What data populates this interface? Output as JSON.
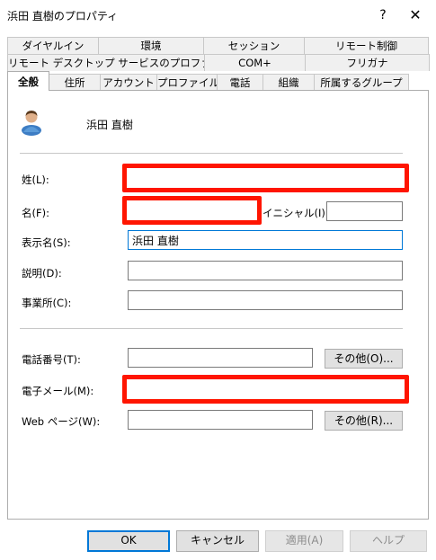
{
  "window": {
    "title": "浜田 直樹のプロパティ",
    "help_label": "?",
    "close_label": "✕"
  },
  "tabs": {
    "row1": [
      "ダイヤルイン",
      "環境",
      "セッション",
      "リモート制御"
    ],
    "row2": [
      "リモート デスクトップ サービスのプロファイル",
      "COM+",
      "フリガナ"
    ],
    "row3": [
      "全般",
      "住所",
      "アカウント",
      "プロファイル",
      "電話",
      "組織",
      "所属するグループ"
    ],
    "active": "全般"
  },
  "general": {
    "user_display": "浜田 直樹",
    "last_name_label": "姓(L):",
    "last_name_value": "",
    "first_name_label": "名(F):",
    "first_name_value": "",
    "initials_label": "イニシャル(I):",
    "initials_value": "",
    "display_name_label": "表示名(S):",
    "display_name_value": "浜田 直樹",
    "description_label": "説明(D):",
    "description_value": "",
    "office_label": "事業所(C):",
    "office_value": "",
    "phone_label": "電話番号(T):",
    "phone_value": "",
    "phone_other_label": "その他(O)...",
    "email_label": "電子メール(M):",
    "email_value": "",
    "webpage_label": "Web ページ(W):",
    "webpage_value": "",
    "webpage_other_label": "その他(R)..."
  },
  "buttons": {
    "ok": "OK",
    "cancel": "キャンセル",
    "apply": "適用(A)",
    "help": "ヘルプ"
  },
  "colors": {
    "highlight": "#ff1500",
    "focus": "#0078d7"
  }
}
